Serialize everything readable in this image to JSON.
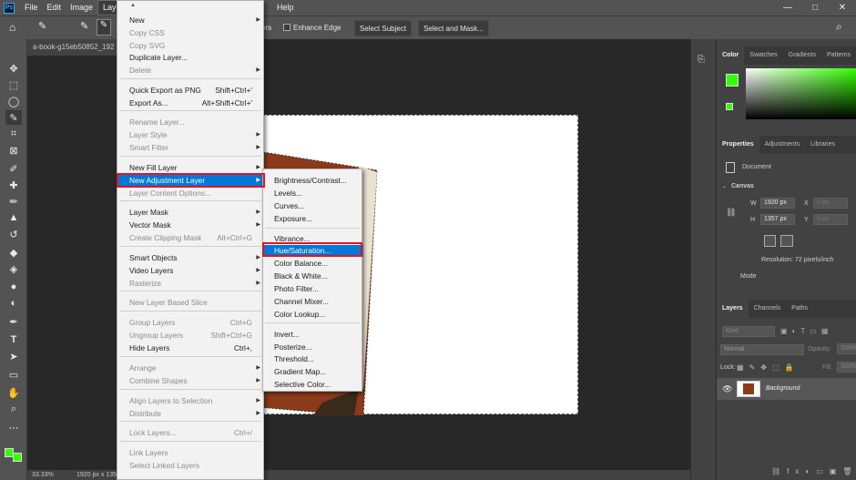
{
  "menubar": {
    "logo": "Ps",
    "items": [
      "File",
      "Edit",
      "Image",
      "Layer"
    ],
    "help": "Help",
    "win_controls": [
      "—",
      "□",
      "✕"
    ]
  },
  "optbar": {
    "partial_label": "ers",
    "enhance_edge": "Enhance Edge",
    "select_subject": "Select Subject",
    "select_and_mask": "Select and Mask..."
  },
  "doc": {
    "tab_title": "a-book-g15eb50852_192",
    "zoom": "33.33%",
    "size_status": "1920 px x 135"
  },
  "layer_menu": {
    "items": [
      {
        "label": "New",
        "shortcut": "",
        "sub": true,
        "disabled": false
      },
      {
        "label": "Copy CSS",
        "shortcut": "",
        "sub": false,
        "disabled": true
      },
      {
        "label": "Copy SVG",
        "shortcut": "",
        "sub": false,
        "disabled": true
      },
      {
        "label": "Duplicate Layer...",
        "shortcut": "",
        "sub": false,
        "disabled": false
      },
      {
        "label": "Delete",
        "shortcut": "",
        "sub": true,
        "disabled": true
      },
      {
        "label": "Quick Export as PNG",
        "shortcut": "Shift+Ctrl+'",
        "sub": false,
        "disabled": false
      },
      {
        "label": "Export As...",
        "shortcut": "Alt+Shift+Ctrl+'",
        "sub": false,
        "disabled": false
      },
      {
        "label": "Rename Layer...",
        "shortcut": "",
        "sub": false,
        "disabled": true
      },
      {
        "label": "Layer Style",
        "shortcut": "",
        "sub": true,
        "disabled": true
      },
      {
        "label": "Smart Filter",
        "shortcut": "",
        "sub": true,
        "disabled": true
      },
      {
        "label": "New Fill Layer",
        "shortcut": "",
        "sub": true,
        "disabled": false
      },
      {
        "label": "New Adjustment Layer",
        "shortcut": "",
        "sub": true,
        "disabled": false
      },
      {
        "label": "Layer Content Options...",
        "shortcut": "",
        "sub": false,
        "disabled": true
      },
      {
        "label": "Layer Mask",
        "shortcut": "",
        "sub": true,
        "disabled": false
      },
      {
        "label": "Vector Mask",
        "shortcut": "",
        "sub": true,
        "disabled": false
      },
      {
        "label": "Create Clipping Mask",
        "shortcut": "Alt+Ctrl+G",
        "sub": false,
        "disabled": true
      },
      {
        "label": "Smart Objects",
        "shortcut": "",
        "sub": true,
        "disabled": false
      },
      {
        "label": "Video Layers",
        "shortcut": "",
        "sub": true,
        "disabled": false
      },
      {
        "label": "Rasterize",
        "shortcut": "",
        "sub": true,
        "disabled": true
      },
      {
        "label": "New Layer Based Slice",
        "shortcut": "",
        "sub": false,
        "disabled": true
      },
      {
        "label": "Group Layers",
        "shortcut": "Ctrl+G",
        "sub": false,
        "disabled": true
      },
      {
        "label": "Ungroup Layers",
        "shortcut": "Shift+Ctrl+G",
        "sub": false,
        "disabled": true
      },
      {
        "label": "Hide Layers",
        "shortcut": "Ctrl+,",
        "sub": false,
        "disabled": false
      },
      {
        "label": "Arrange",
        "shortcut": "",
        "sub": true,
        "disabled": true
      },
      {
        "label": "Combine Shapes",
        "shortcut": "",
        "sub": true,
        "disabled": true
      },
      {
        "label": "Align Layers to Selection",
        "shortcut": "",
        "sub": true,
        "disabled": true
      },
      {
        "label": "Distribute",
        "shortcut": "",
        "sub": true,
        "disabled": true
      },
      {
        "label": "Lock Layers...",
        "shortcut": "Ctrl+/",
        "sub": false,
        "disabled": true
      },
      {
        "label": "Link Layers",
        "shortcut": "",
        "sub": false,
        "disabled": true
      },
      {
        "label": "Select Linked Layers",
        "shortcut": "",
        "sub": false,
        "disabled": true
      }
    ]
  },
  "adjust_menu": {
    "items": [
      "Brightness/Contrast...",
      "Levels...",
      "Curves...",
      "Exposure...",
      "Vibrance...",
      "Hue/Saturation...",
      "Color Balance...",
      "Black & White...",
      "Photo Filter...",
      "Channel Mixer...",
      "Color Lookup...",
      "Invert...",
      "Posterize...",
      "Threshold...",
      "Gradient Map...",
      "Selective Color..."
    ]
  },
  "panels": {
    "color_tabs": [
      "Color",
      "Swatches",
      "Gradients",
      "Patterns"
    ],
    "props_tabs": [
      "Properties",
      "Adjustments",
      "Libraries"
    ],
    "document_label": "Document",
    "canvas_label": "Canvas",
    "w_label": "W",
    "h_label": "H",
    "x_label": "X",
    "y_label": "Y",
    "width_value": "1920 px",
    "height_value": "1357 px",
    "x_placeholder": "0 px",
    "y_placeholder": "0 px",
    "resolution": "Resolution: 72 pixels/inch",
    "mode_label": "Mode",
    "layers_tabs": [
      "Layers",
      "Channels",
      "Paths"
    ],
    "kind_placeholder": "Kind",
    "blend_mode": "Normal",
    "opacity_label": "Opacity:",
    "opacity_value": "100%",
    "lock_label": "Lock:",
    "fill_label": "Fill:",
    "fill_value": "100%",
    "layer_name": "Background"
  },
  "colors": {
    "foreground": "#33ff00",
    "highlight": "#0078d7",
    "callout": "#e8111f"
  }
}
